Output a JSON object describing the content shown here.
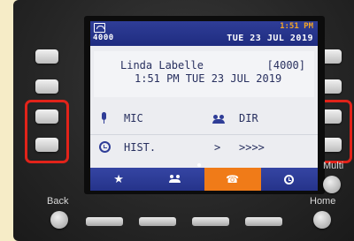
{
  "status_bar": {
    "extension": "4000",
    "time": "1:51 PM",
    "date": "TUE 23 JUL 2019"
  },
  "caller": {
    "name": "Linda Labelle",
    "extension": "[4000]",
    "datetime": "1:51 PM TUE 23 JUL 2019"
  },
  "menu": {
    "mic": "MIC",
    "dir": "DIR",
    "hist": "HIST.",
    "arrow": ">",
    "more": ">>>>"
  },
  "hardware_keys": {
    "back": "Back",
    "multi": "Multi",
    "home": "Home"
  },
  "colors": {
    "accent_blue": "#2f3d97",
    "active_tab": "#f07b18",
    "highlight": "#e2231a",
    "background": "#f6ecc7"
  }
}
